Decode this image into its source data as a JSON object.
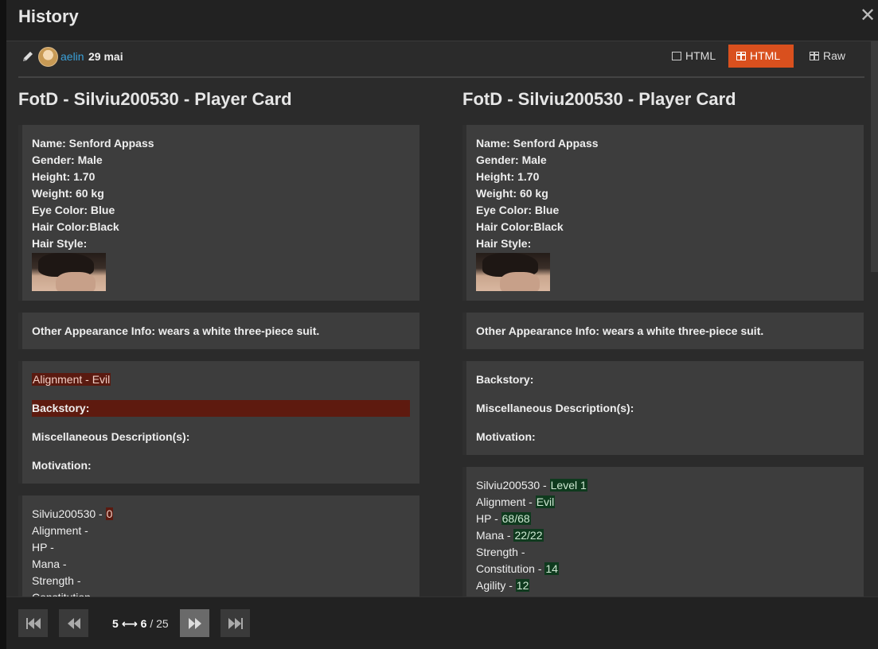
{
  "window": {
    "title": "History",
    "close_symbol": "✕"
  },
  "revision": {
    "author": "aelin",
    "date": "29 mai"
  },
  "view_modes": [
    {
      "label": "HTML",
      "active": false
    },
    {
      "label": "HTML",
      "active": true
    },
    {
      "label": "Raw",
      "active": false
    }
  ],
  "colors": {
    "accent": "#d9501e",
    "link": "#3aa0d8",
    "deleted_bg": "#5a1a10",
    "inserted_bg": "#0f3a1e"
  },
  "left": {
    "title": "FotD - Silviu200530 - Player Card",
    "appearance": {
      "name": "Name: Senford Appass",
      "gender": "Gender: Male",
      "height": "Height: 1.70",
      "weight": "Weight: 60 kg",
      "eye": "Eye Color: Blue",
      "hair_color": "Hair Color:Black",
      "hair_style": "Hair Style:"
    },
    "other": "Other Appearance Info: wears a white three-piece suit.",
    "story": {
      "alignment": "Alignment - Evil",
      "backstory": "Backstory:",
      "misc": "Miscellaneous Description(s):",
      "motivation": "Motivation:"
    },
    "stats": {
      "name_prefix": "Silviu200530 - ",
      "name_value": "0",
      "alignment": "Alignment -",
      "hp": "HP -",
      "mana": "Mana -",
      "strength": "Strength -",
      "constitution": "Constitution -"
    }
  },
  "right": {
    "title": "FotD - Silviu200530 - Player Card",
    "appearance": {
      "name": "Name: Senford Appass",
      "gender": "Gender: Male",
      "height": "Height: 1.70",
      "weight": "Weight: 60 kg",
      "eye": "Eye Color: Blue",
      "hair_color": "Hair Color:Black",
      "hair_style": "Hair Style:"
    },
    "other": "Other Appearance Info: wears a white three-piece suit.",
    "story": {
      "backstory": "Backstory:",
      "misc": "Miscellaneous Description(s):",
      "motivation": "Motivation:"
    },
    "stats": {
      "name_prefix": "Silviu200530 - ",
      "name_value": "Level 1",
      "alignment_prefix": "Alignment - ",
      "alignment_value": "Evil",
      "hp_prefix": "HP - ",
      "hp_value": "68/68",
      "mana_prefix": "Mana - ",
      "mana_value": "22/22",
      "strength": "Strength -",
      "constitution_prefix": "Constitution - ",
      "constitution_value": "14",
      "agility_prefix": "Agility - ",
      "agility_value": "12"
    }
  },
  "pagination": {
    "from": "5",
    "arrow": "⟷",
    "to": "6",
    "separator": " / ",
    "total": "25"
  }
}
